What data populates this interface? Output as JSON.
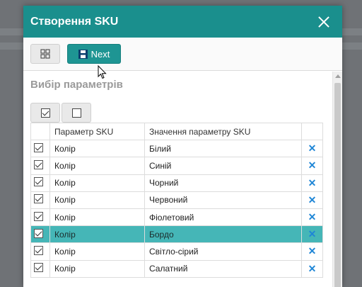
{
  "dialog": {
    "title": "Створення SKU",
    "close_icon": "close-icon"
  },
  "toolbar": {
    "grid_icon": "grid-icon",
    "next_label": "Next",
    "next_icon": "save-icon"
  },
  "section": {
    "title": "Вибір параметрів"
  },
  "table": {
    "headers": [
      "Параметр SKU",
      "Значення параметру SKU"
    ],
    "rows": [
      {
        "param": "Колір",
        "value": "Білий",
        "checked": true
      },
      {
        "param": "Колір",
        "value": "Синій",
        "checked": true
      },
      {
        "param": "Колір",
        "value": "Чорний",
        "checked": true
      },
      {
        "param": "Колір",
        "value": "Червоний",
        "checked": true
      },
      {
        "param": "Колір",
        "value": "Фіолетовий",
        "checked": true
      },
      {
        "param": "Колір",
        "value": "Бордо",
        "checked": true,
        "selected": true
      },
      {
        "param": "Колір",
        "value": "Світло-сірий",
        "checked": true
      },
      {
        "param": "Колір",
        "value": "Салатний",
        "checked": true
      }
    ],
    "delete_icon": "✕"
  },
  "colors": {
    "titlebar": "#1a8f8d",
    "accent": "#1e9593",
    "selected_row": "#45b6b7",
    "delete_icon": "#1f86d6"
  }
}
